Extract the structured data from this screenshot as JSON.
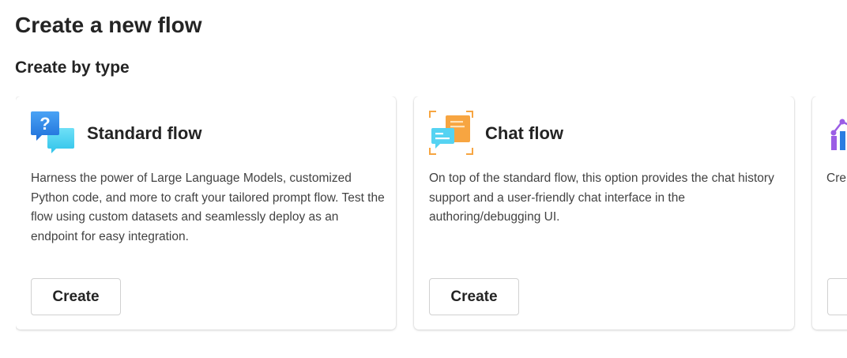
{
  "page": {
    "title": "Create a new flow"
  },
  "section": {
    "title": "Create by type"
  },
  "cards": [
    {
      "title": "Standard flow",
      "description": "Harness the power of Large Language Models, customized Python code, and more to craft your tailored prompt flow. Test the flow using custom datasets and seamlessly deploy as an endpoint for easy integration.",
      "button": "Create",
      "icon": "chat-question-icon"
    },
    {
      "title": "Chat flow",
      "description": "On top of the standard flow, this option provides the chat history support and a user-friendly chat interface in the authoring/debugging UI.",
      "button": "Create",
      "icon": "chat-bubbles-icon"
    },
    {
      "title": "",
      "description": "Cre out",
      "button": "",
      "icon": "evaluation-chart-icon"
    }
  ],
  "colors": {
    "accent_blue": "#3aa0f3",
    "accent_cyan": "#50d0f0",
    "accent_orange": "#f7a541",
    "accent_purple": "#9b5de5",
    "text_primary": "#242424",
    "text_secondary": "#424242"
  }
}
